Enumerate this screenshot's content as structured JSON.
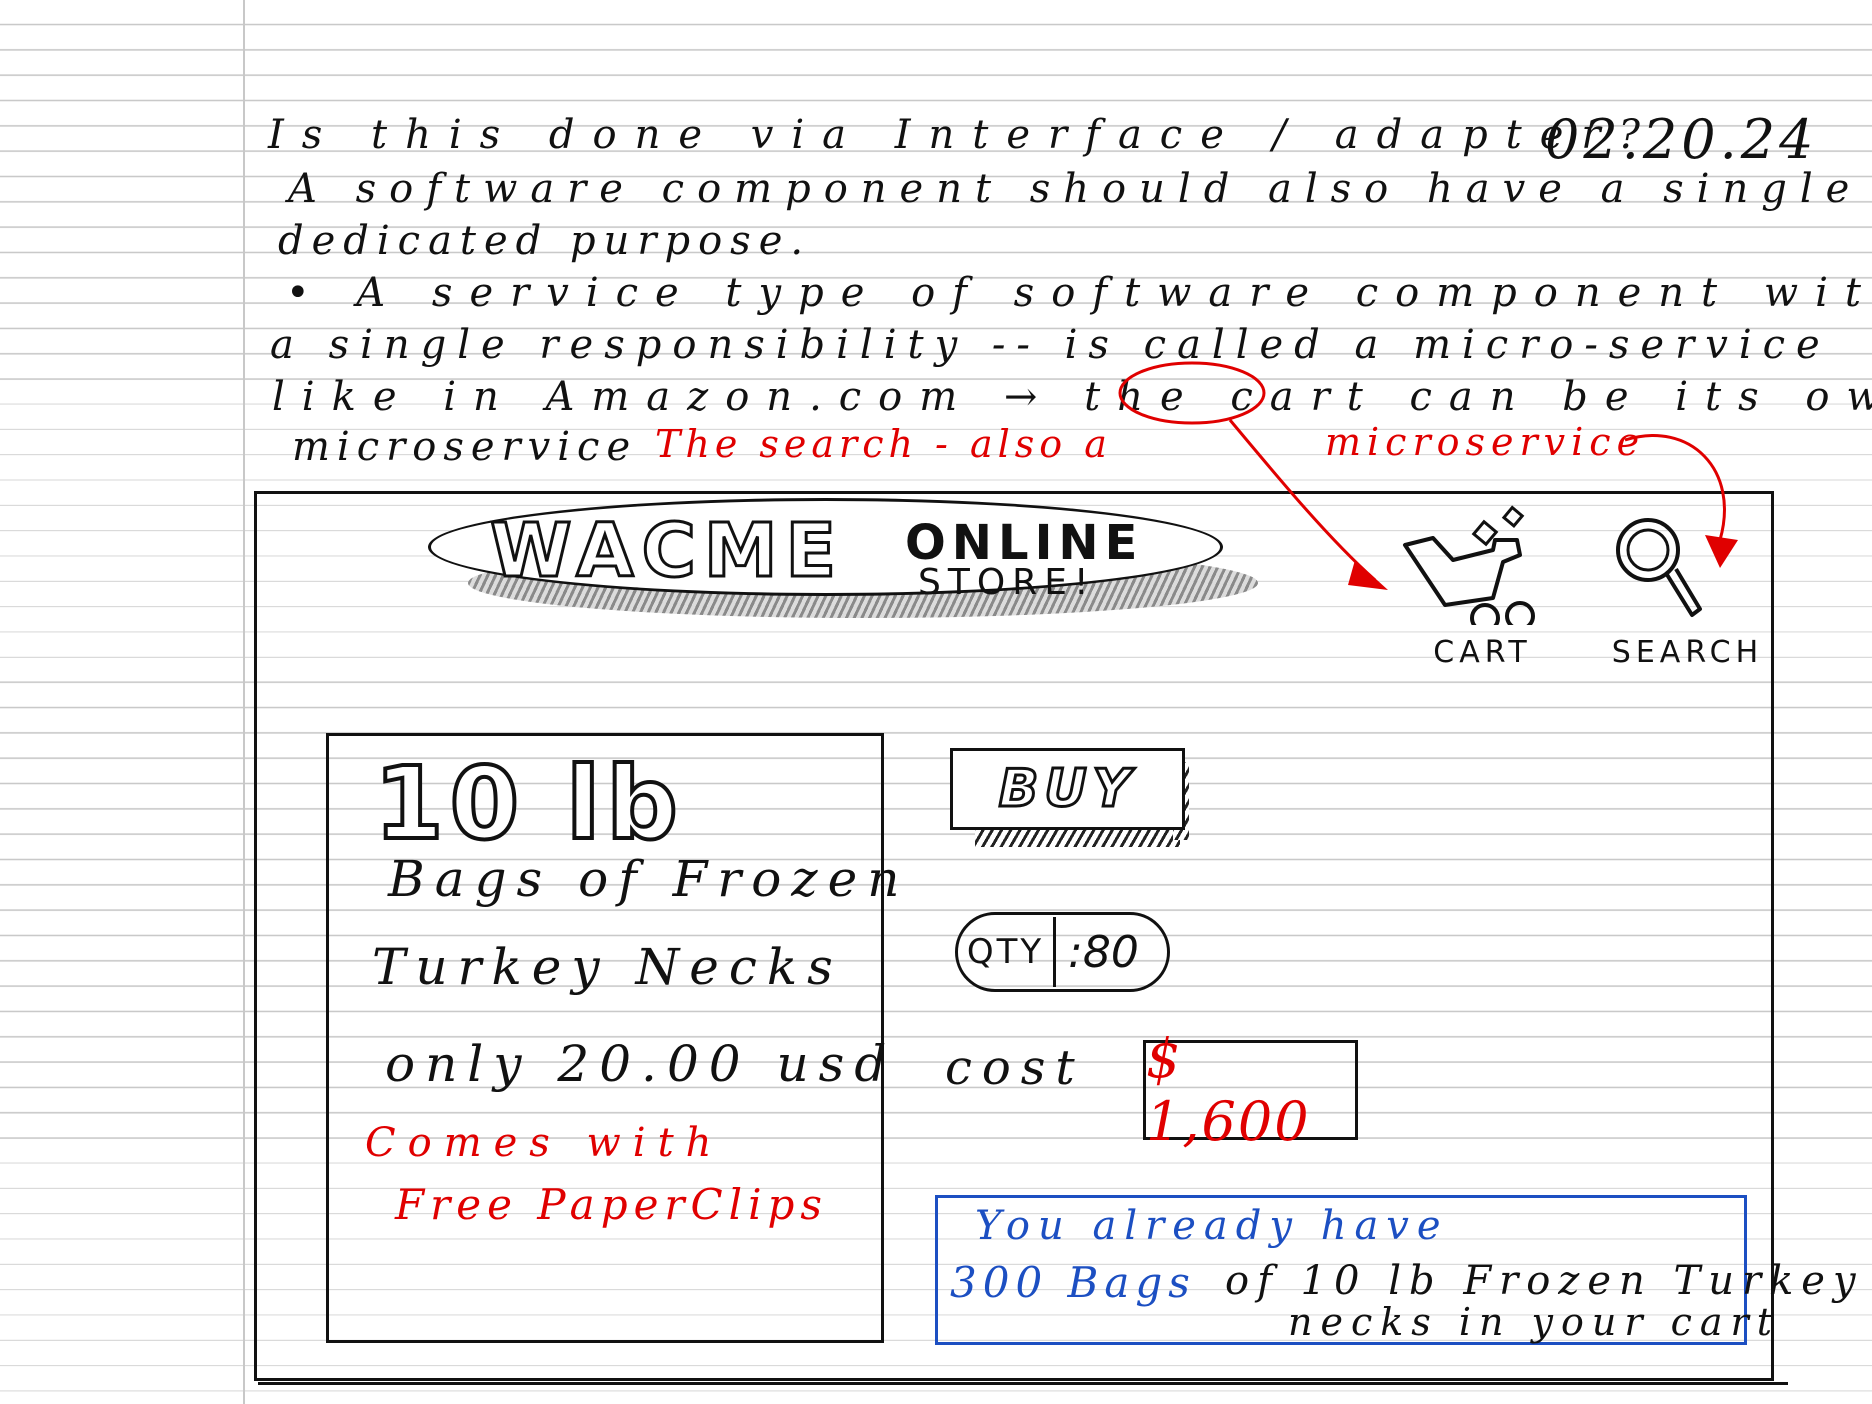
{
  "notes": {
    "date": "02.20.24",
    "lines": [
      "Is this done via Interface / adapter?",
      "A software component should also have a single",
      "dedicated purpose.",
      "• A service type of software component with",
      "a single responsibility -- is called a micro-service",
      "like in Amazon.com → the cart can be its own",
      "microservice"
    ],
    "red_search_note": "The search - also a",
    "red_microservice": "microservice"
  },
  "store": {
    "logo_name": "WACME",
    "logo_online": "ONLINE",
    "logo_store": "STORE!",
    "cart_label": "CART",
    "search_label": "SEARCH",
    "product": {
      "weight": "10 lb",
      "name_line1": "Bags of Frozen",
      "name_line2": "Turkey Necks",
      "price": "only 20.00 usd",
      "promo_line1": "Comes with",
      "promo_line2": "Free PaperClips"
    },
    "buy_label": "BUY",
    "qty_label": "QTY",
    "qty_value": ":80",
    "cost_label": "cost",
    "cost_value": "$ 1,600",
    "cart_note": {
      "line1": "You already have",
      "count": "300 Bags",
      "line2_rest": "of 10 lb Frozen Turkey",
      "line3": "necks in your cart"
    }
  },
  "colors": {
    "ink": "#111111",
    "red_ink": "#e00000",
    "blue_ink": "#1c4fc2",
    "paper_rule": "#c9c9c9"
  }
}
